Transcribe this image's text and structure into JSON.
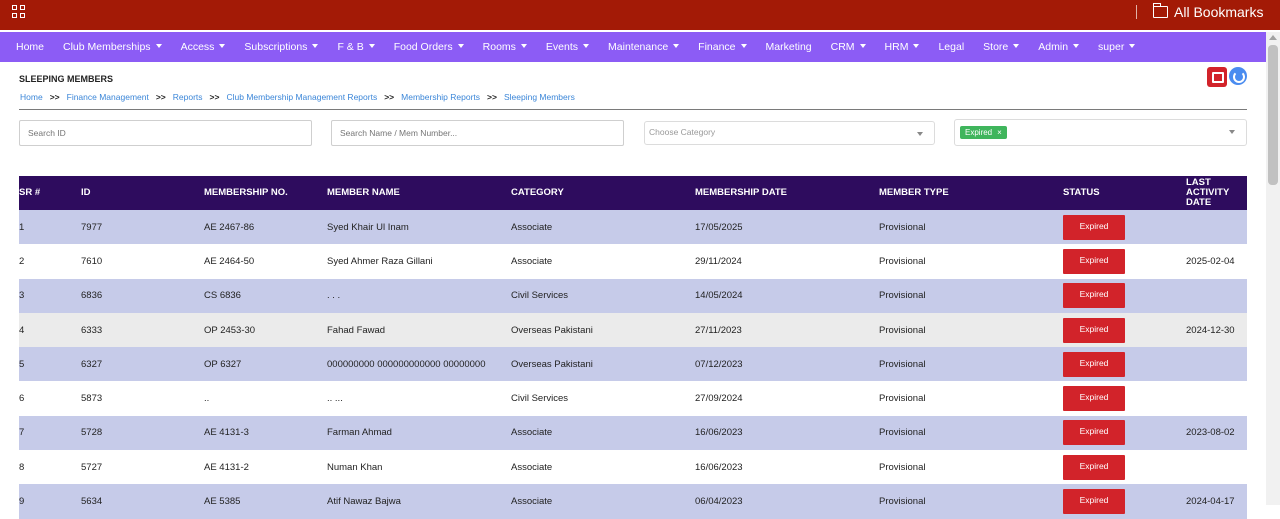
{
  "topbar": {
    "bookmarks_label": "All Bookmarks"
  },
  "nav": [
    {
      "label": "Home",
      "dropdown": false
    },
    {
      "label": "Club Memberships",
      "dropdown": true
    },
    {
      "label": "Access",
      "dropdown": true
    },
    {
      "label": "Subscriptions",
      "dropdown": true
    },
    {
      "label": "F & B",
      "dropdown": true
    },
    {
      "label": "Food Orders",
      "dropdown": true
    },
    {
      "label": "Rooms",
      "dropdown": true
    },
    {
      "label": "Events",
      "dropdown": true
    },
    {
      "label": "Maintenance",
      "dropdown": true
    },
    {
      "label": "Finance",
      "dropdown": true
    },
    {
      "label": "Marketing",
      "dropdown": false
    },
    {
      "label": "CRM",
      "dropdown": true
    },
    {
      "label": "HRM",
      "dropdown": true
    },
    {
      "label": "Legal",
      "dropdown": false
    },
    {
      "label": "Store",
      "dropdown": true
    },
    {
      "label": "Admin",
      "dropdown": true
    },
    {
      "label": "super",
      "dropdown": true
    }
  ],
  "page": {
    "title": "SLEEPING MEMBERS"
  },
  "breadcrumb": {
    "separator": ">>",
    "items": [
      "Home",
      "Finance Management",
      "Reports",
      "Club Membership Management Reports",
      "Membership Reports",
      "Sleeping Members"
    ]
  },
  "filters": {
    "search_id_placeholder": "Search ID",
    "search_name_placeholder": "Search Name / Mem Number...",
    "category_placeholder": "Choose Category",
    "status_tag": "Expired",
    "tag_remove": "×"
  },
  "table": {
    "headers": [
      "SR #",
      "ID",
      "MEMBERSHIP NO.",
      "MEMBER NAME",
      "CATEGORY",
      "MEMBERSHIP DATE",
      "MEMBER TYPE",
      "STATUS",
      "LAST ACTIVITY DATE"
    ],
    "rows": [
      {
        "sr": "1",
        "id": "7977",
        "mno": "AE 2467-86",
        "name": "Syed Khair Ul Inam",
        "category": "Associate",
        "date": "17/05/2025",
        "type": "Provisional",
        "status": "Expired",
        "last": ""
      },
      {
        "sr": "2",
        "id": "7610",
        "mno": "AE 2464-50",
        "name": "Syed Ahmer Raza Gillani",
        "category": "Associate",
        "date": "29/11/2024",
        "type": "Provisional",
        "status": "Expired",
        "last": "2025-02-04"
      },
      {
        "sr": "3",
        "id": "6836",
        "mno": "CS 6836",
        "name": ". . .",
        "category": "Civil Services",
        "date": "14/05/2024",
        "type": "Provisional",
        "status": "Expired",
        "last": ""
      },
      {
        "sr": "4",
        "id": "6333",
        "mno": "OP 2453-30",
        "name": "Fahad Fawad",
        "category": "Overseas Pakistani",
        "date": "27/11/2023",
        "type": "Provisional",
        "status": "Expired",
        "last": "2024-12-30"
      },
      {
        "sr": "5",
        "id": "6327",
        "mno": "OP 6327",
        "name": "000000000 000000000000 00000000",
        "category": "Overseas Pakistani",
        "date": "07/12/2023",
        "type": "Provisional",
        "status": "Expired",
        "last": ""
      },
      {
        "sr": "6",
        "id": "5873",
        "mno": "..",
        "name": ".. ...",
        "category": "Civil Services",
        "date": "27/09/2024",
        "type": "Provisional",
        "status": "Expired",
        "last": ""
      },
      {
        "sr": "7",
        "id": "5728",
        "mno": "AE 4131-3",
        "name": "Farman Ahmad",
        "category": "Associate",
        "date": "16/06/2023",
        "type": "Provisional",
        "status": "Expired",
        "last": "2023-08-02"
      },
      {
        "sr": "8",
        "id": "5727",
        "mno": "AE 4131-2",
        "name": "Numan Khan",
        "category": "Associate",
        "date": "16/06/2023",
        "type": "Provisional",
        "status": "Expired",
        "last": ""
      },
      {
        "sr": "9",
        "id": "5634",
        "mno": "AE 5385",
        "name": "Atif Nawaz Bajwa",
        "category": "Associate",
        "date": "06/04/2023",
        "type": "Provisional",
        "status": "Expired",
        "last": "2024-04-17"
      }
    ]
  },
  "colors": {
    "topbar": "#a31a06",
    "navbar": "#8c5cf5",
    "table_header": "#2e0c5e",
    "status_expired": "#d2232a",
    "tag_green": "#3fb55c",
    "link": "#3b86d8"
  }
}
